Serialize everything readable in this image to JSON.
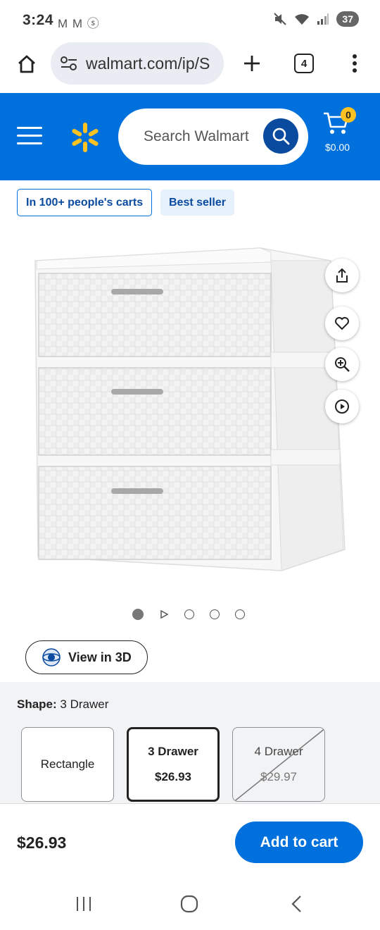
{
  "status": {
    "time": "3:24",
    "notifications": "M M ⓢ",
    "battery": "37"
  },
  "browser": {
    "url": "walmart.com/ip/S",
    "tab_count": "4"
  },
  "header": {
    "search_placeholder": "Search Walmart",
    "cart_count": "0",
    "cart_total": "$0.00",
    "brand_color": "#0071dc",
    "spark_color": "#ffc220"
  },
  "badges": {
    "carts": "In 100+ people's carts",
    "best_seller": "Best seller"
  },
  "carousel": {
    "view_3d_label": "View in 3D"
  },
  "shape": {
    "label": "Shape:",
    "value": "3 Drawer",
    "options": [
      {
        "name": "Rectangle",
        "price": ""
      },
      {
        "name": "3 Drawer",
        "price": "$26.93"
      },
      {
        "name": "4 Drawer",
        "price": "$29.97"
      }
    ]
  },
  "bottom_bar": {
    "price": "$26.93",
    "add_to_cart": "Add to cart"
  }
}
